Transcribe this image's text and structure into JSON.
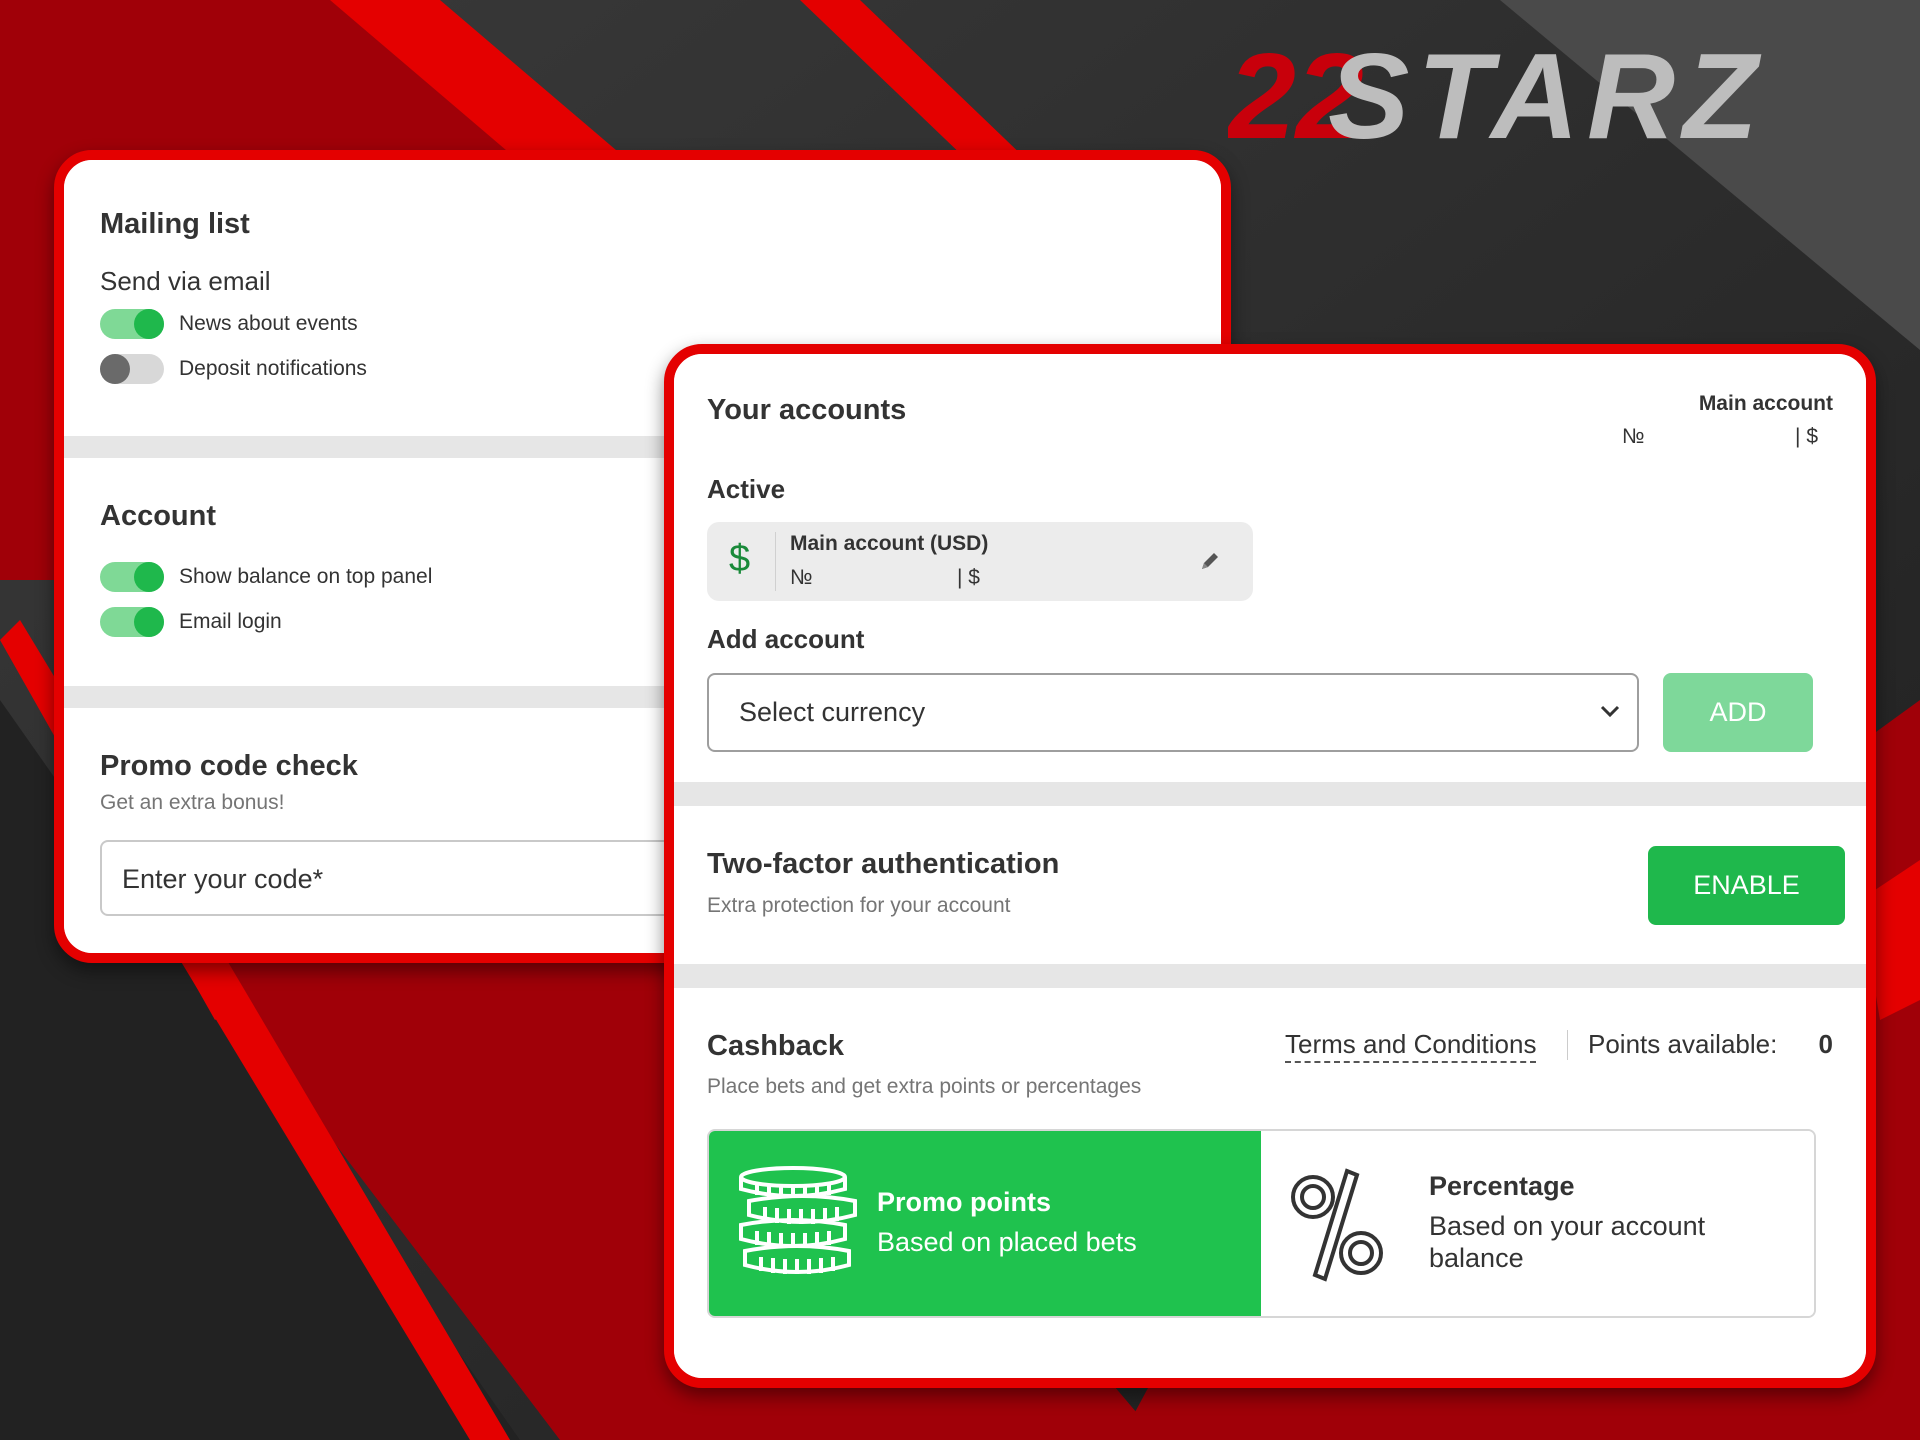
{
  "brand": {
    "logo_text": "22STARZ"
  },
  "mailing": {
    "title": "Mailing list",
    "subtitle": "Send via email",
    "toggles": [
      {
        "label": "News about events",
        "on": true
      },
      {
        "label": "Deposit notifications",
        "on": false
      }
    ]
  },
  "account_settings": {
    "title": "Account",
    "toggles": [
      {
        "label": "Show balance on top panel",
        "on": true
      },
      {
        "label": "Email login",
        "on": true
      }
    ]
  },
  "promo": {
    "title": "Promo code check",
    "subtitle": "Get an extra bonus!",
    "placeholder": "Enter your code*"
  },
  "accounts": {
    "title": "Your accounts",
    "main_label": "Main account",
    "main_number_prefix": "№",
    "main_currency": "| $",
    "active_label": "Active",
    "active_card": {
      "currency_symbol": "$",
      "name": "Main account (USD)",
      "number_prefix": "№",
      "balance_suffix": "| $"
    },
    "add_label": "Add account",
    "select_placeholder": "Select currency",
    "add_button": "ADD"
  },
  "two_factor": {
    "title": "Two-factor authentication",
    "subtitle": "Extra protection for your account",
    "button": "ENABLE"
  },
  "cashback": {
    "title": "Cashback",
    "subtitle": "Place bets and get extra points or percentages",
    "terms_link": "Terms and Conditions",
    "points_label": "Points available:",
    "points_value": "0",
    "options": [
      {
        "title": "Promo points",
        "subtitle": "Based on placed bets",
        "selected": true,
        "icon": "coins-icon"
      },
      {
        "title": "Percentage",
        "subtitle_line1": "Based on your account",
        "subtitle_line2": "balance",
        "selected": false,
        "icon": "percent-icon"
      }
    ]
  },
  "colors": {
    "brand_red": "#e40000",
    "dark_red": "#a00008",
    "green": "#1fb84c",
    "light_green": "#7fd996",
    "text": "#333333",
    "muted": "#757575"
  }
}
